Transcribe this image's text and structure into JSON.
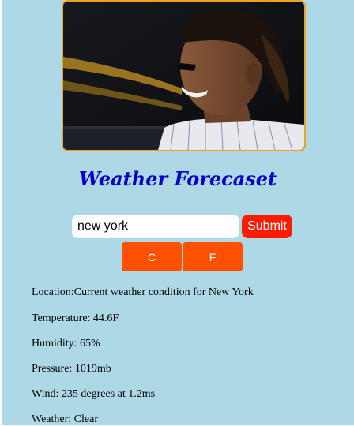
{
  "header": {
    "title": "Weather Forecaset"
  },
  "search": {
    "value": "new york",
    "submit_label": "Submit"
  },
  "units": {
    "celsius_label": "C",
    "fahrenheit_label": "F"
  },
  "weather": {
    "location": "Location:Current weather condition for New York",
    "temperature": "Temperature: 44.6F",
    "humidity": "Humidity: 65%",
    "pressure": "Pressure: 1019mb",
    "wind": "Wind: 235 degrees at 1.2ms",
    "conditions": "Weather: Clear"
  },
  "colors": {
    "background": "#add8e6",
    "title": "#0000cd",
    "submit": "#ff1a00",
    "unit_buttons": "#ff5000",
    "image_border": "#f0a020"
  }
}
